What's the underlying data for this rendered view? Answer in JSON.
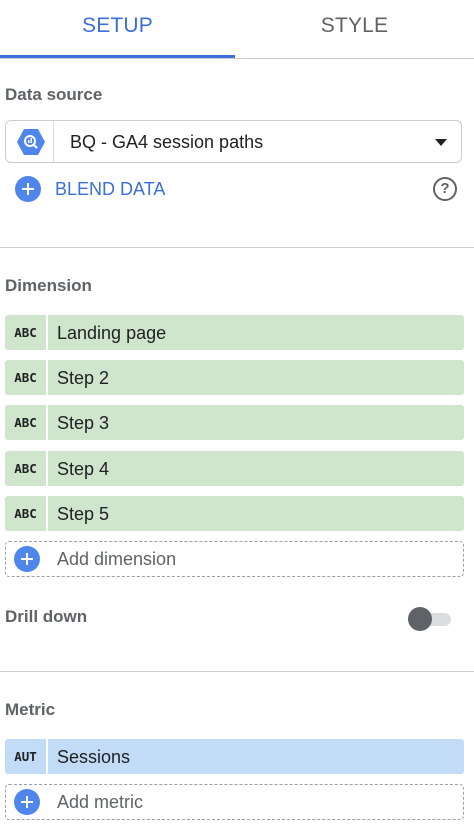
{
  "tabs": {
    "setup": "SETUP",
    "style": "STYLE",
    "active": "setup"
  },
  "colors": {
    "accent": "#3c6fd8",
    "dimension_chip": "#cfe6cc",
    "metric_chip": "#c2dcf7",
    "add_icon": "#4f86ec"
  },
  "data_source": {
    "label": "Data source",
    "selected": "BQ - GA4 session paths",
    "icon": "bigquery-icon",
    "blend_label": "BLEND DATA",
    "help_glyph": "?"
  },
  "dimension": {
    "label": "Dimension",
    "items": [
      {
        "type": "ABC",
        "label": "Landing page"
      },
      {
        "type": "ABC",
        "label": "Step 2"
      },
      {
        "type": "ABC",
        "label": "Step 3"
      },
      {
        "type": "ABC",
        "label": "Step 4"
      },
      {
        "type": "ABC",
        "label": "Step 5"
      }
    ],
    "add_label": "Add dimension"
  },
  "drill_down": {
    "label": "Drill down",
    "enabled": false
  },
  "metric": {
    "label": "Metric",
    "items": [
      {
        "type": "AUT",
        "label": "Sessions"
      }
    ],
    "add_label": "Add metric"
  }
}
